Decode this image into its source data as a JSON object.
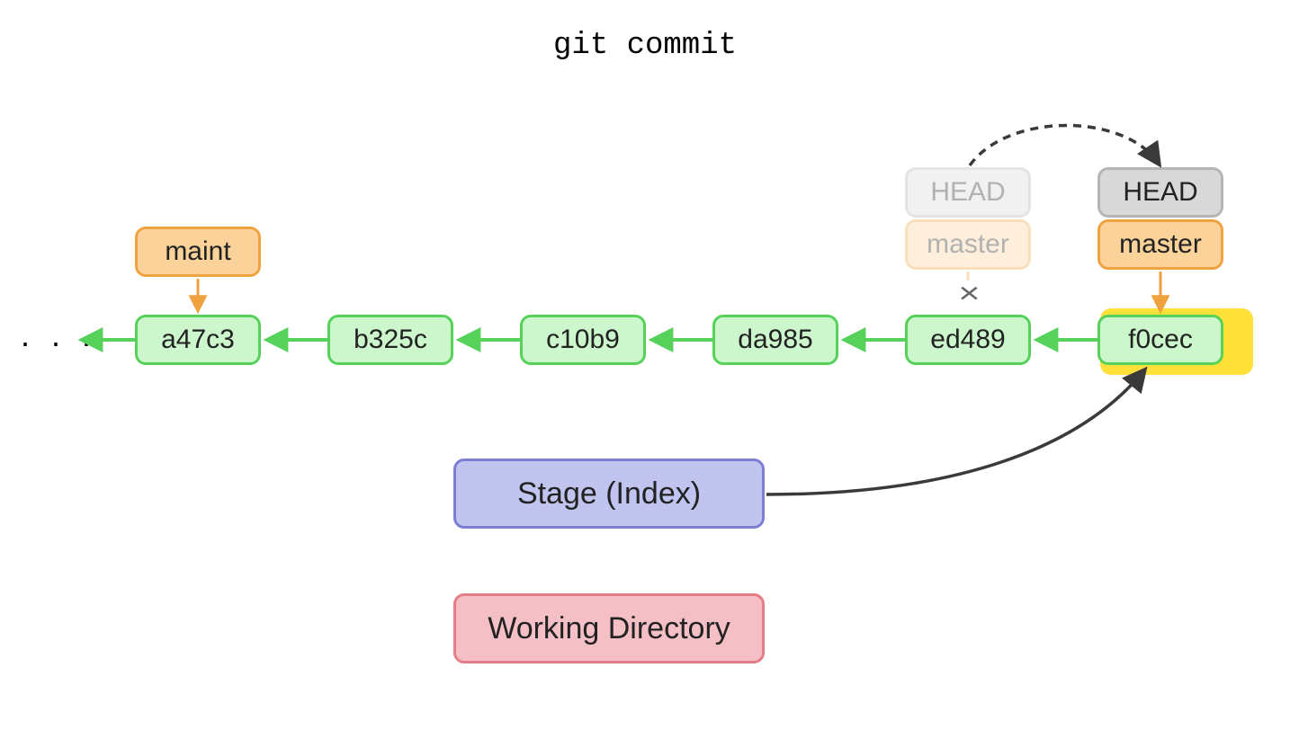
{
  "title": "git commit",
  "commits": [
    "a47c3",
    "b325c",
    "c10b9",
    "da985",
    "ed489",
    "f0cec"
  ],
  "branches": {
    "maint": "maint",
    "master_old": "master",
    "master_new": "master"
  },
  "head": {
    "old": "HEAD",
    "new": "HEAD"
  },
  "stage": "Stage (Index)",
  "workdir": "Working Directory",
  "ellipsis": "· · ·",
  "xmark": "×",
  "colors": {
    "commit_fill": "#ccf6cc",
    "commit_border": "#56d15a",
    "branch_fill": "#fbd39a",
    "branch_border": "#f0a23f",
    "head_fill": "#d8d8d8",
    "head_border": "#b5b5b5",
    "stage_fill": "#c0c4ee",
    "stage_border": "#7c7ed3",
    "workdir_fill": "#f5c0c5",
    "workdir_border": "#e57d89",
    "highlight": "#ffe13a",
    "arrow_green": "#56d15a",
    "arrow_orange": "#f0a23f",
    "arrow_dark": "#3a3a3a"
  }
}
